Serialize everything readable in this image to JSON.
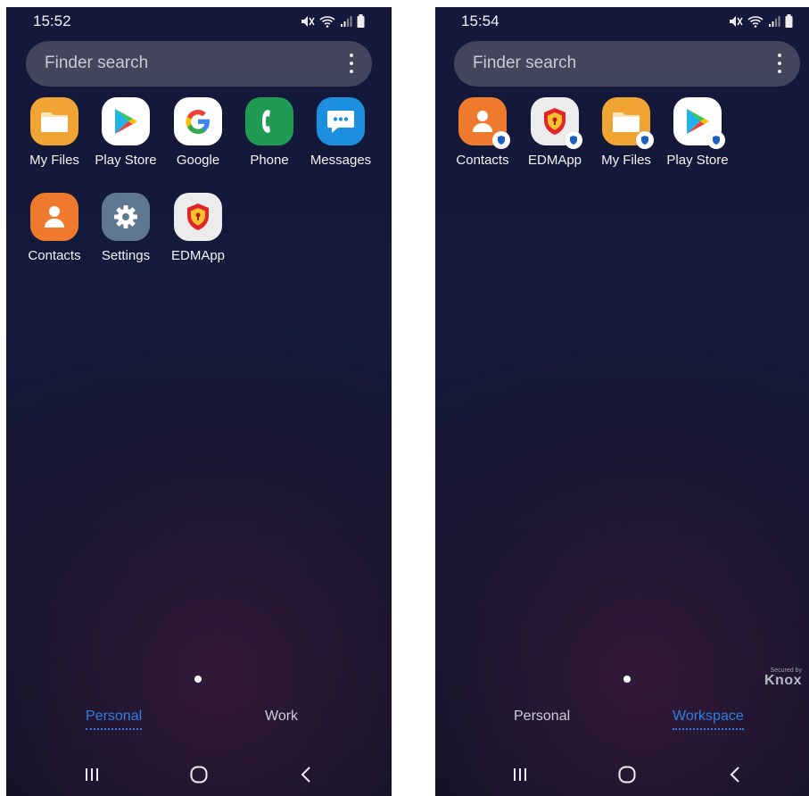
{
  "screens": {
    "personal": {
      "time": "15:52",
      "search": {
        "placeholder": "Finder search"
      },
      "apps": [
        {
          "label": "My Files",
          "icon": "folder-icon"
        },
        {
          "label": "Play Store",
          "icon": "play-store-icon"
        },
        {
          "label": "Google",
          "icon": "google-icon"
        },
        {
          "label": "Phone",
          "icon": "phone-icon"
        },
        {
          "label": "Messages",
          "icon": "messages-icon"
        },
        {
          "label": "Contacts",
          "icon": "contacts-icon"
        },
        {
          "label": "Settings",
          "icon": "gear-icon"
        },
        {
          "label": "EDMApp",
          "icon": "shield-icon"
        }
      ],
      "tabs": [
        {
          "label": "Personal",
          "active": true
        },
        {
          "label": "Work",
          "active": false
        }
      ]
    },
    "workspace": {
      "time": "15:54",
      "search": {
        "placeholder": "Finder search"
      },
      "apps": [
        {
          "label": "Contacts",
          "icon": "contacts-icon",
          "badge": "knox-badge-icon"
        },
        {
          "label": "EDMApp",
          "icon": "shield-icon",
          "badge": "knox-badge-icon"
        },
        {
          "label": "My Files",
          "icon": "folder-icon",
          "badge": "knox-badge-icon"
        },
        {
          "label": "Play Store",
          "icon": "play-store-icon",
          "badge": "knox-badge-icon"
        }
      ],
      "tabs": [
        {
          "label": "Personal",
          "active": false
        },
        {
          "label": "Workspace",
          "active": true
        }
      ],
      "knox": {
        "secured_by": "Secured by",
        "brand": "Knox"
      }
    }
  },
  "colors": {
    "active_tab": "#2d7fe3",
    "my_files": "#f0a434",
    "phone": "#1f9b54",
    "messages": "#1c8fe0",
    "contacts": "#ef7a2e",
    "settings": "#5f7891",
    "edm_shield": "#e0262a"
  }
}
